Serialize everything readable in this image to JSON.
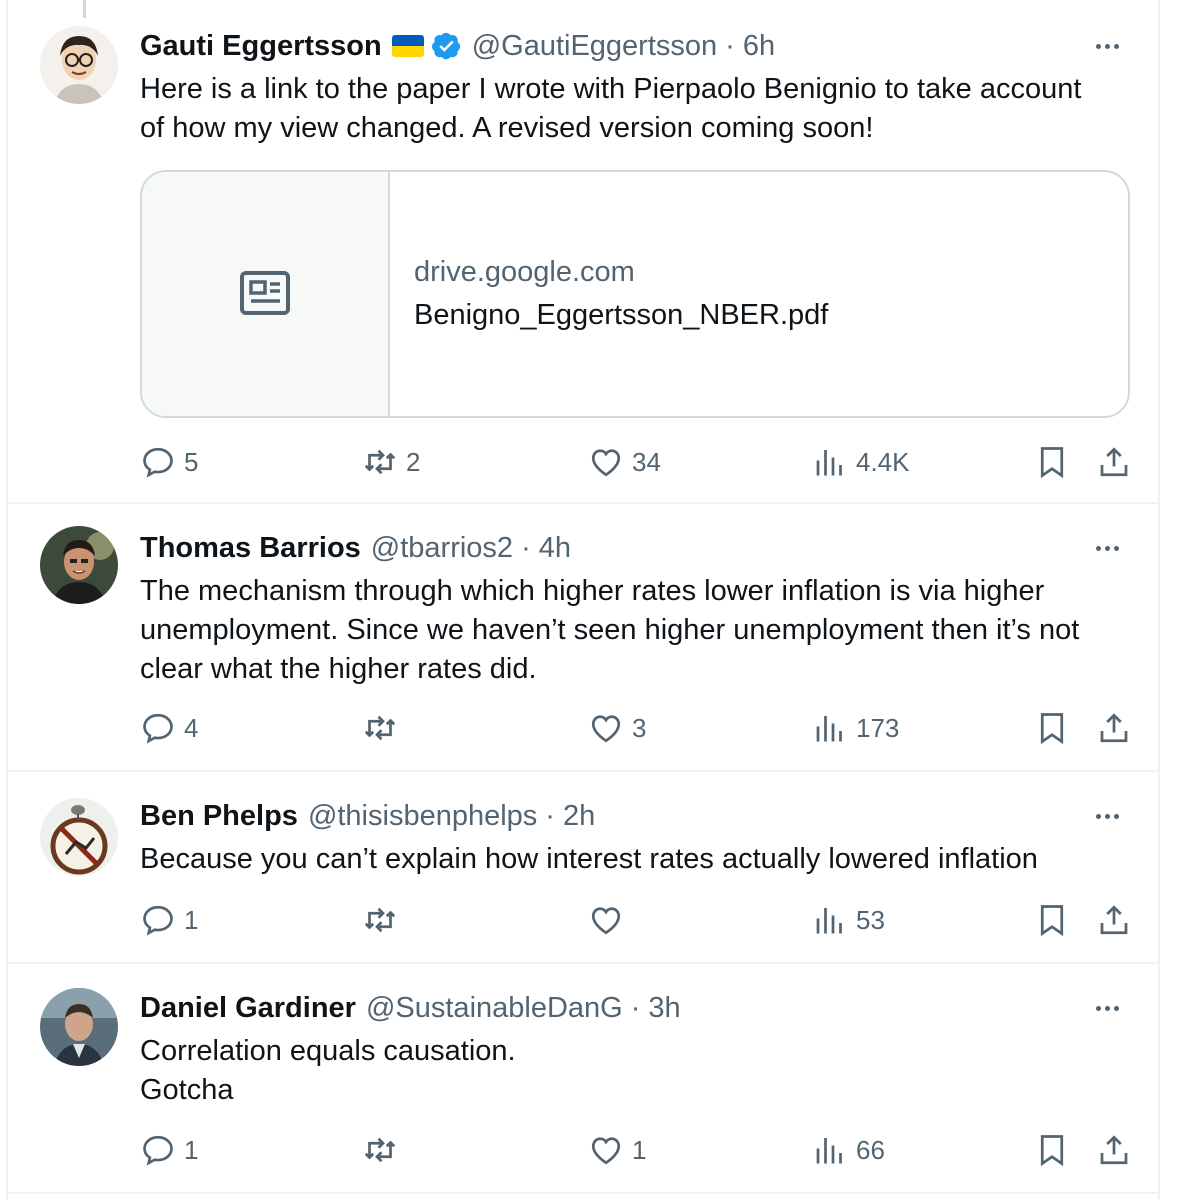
{
  "colors": {
    "accent": "#1d9bf0",
    "muted": "#536471",
    "text": "#0f1419",
    "border": "#cfd9de"
  },
  "tweets": [
    {
      "name": "Gauti Eggertsson",
      "flag": "ukraine-flag-icon",
      "verified": true,
      "handle": "@GautiEggertsson",
      "sep": "·",
      "time": "6h",
      "text": "Here is a link to the paper I wrote with Pierpaolo Benignio to take account\nof how my view changed. A revised version coming soon!",
      "card": {
        "domain": "drive.google.com",
        "title": "Benigno_Eggertsson_NBER.pdf",
        "icon": "article-icon"
      },
      "replies": "5",
      "retweets": "2",
      "likes": "34",
      "views": "4.4K"
    },
    {
      "name": "Thomas Barrios",
      "handle": "@tbarrios2",
      "sep": "·",
      "time": "4h",
      "text": "The mechanism through which higher rates lower inflation is via higher\nunemployment. Since we haven’t seen higher unemployment then it’s not\nclear what the higher rates did.",
      "replies": "4",
      "retweets": "",
      "likes": "3",
      "views": "173"
    },
    {
      "name": "Ben Phelps",
      "handle": "@thisisbenphelps",
      "sep": "·",
      "time": "2h",
      "text": "Because you can’t explain how interest rates actually lowered inflation",
      "replies": "1",
      "retweets": "",
      "likes": "",
      "views": "53"
    },
    {
      "name": "Daniel Gardiner",
      "handle": "@SustainableDanG",
      "sep": "·",
      "time": "3h",
      "text": "Correlation equals causation.\nGotcha",
      "replies": "1",
      "retweets": "",
      "likes": "1",
      "views": "66"
    }
  ]
}
